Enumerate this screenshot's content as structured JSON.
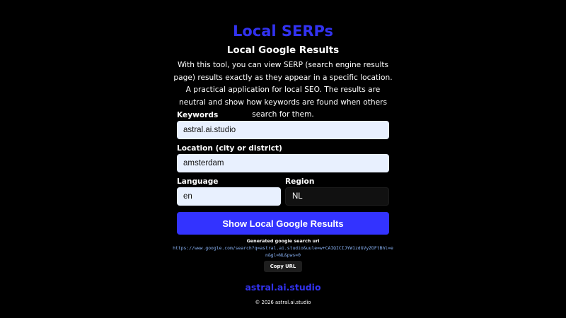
{
  "header": {
    "title": "Local SERPs",
    "subtitle": "Local Google Results",
    "description": "With this tool, you can view SERP (search engine results page) results exactly as they appear in a specific location. A practical application for local SEO. The results are neutral and show how keywords are found when others search for them."
  },
  "form": {
    "keywords": {
      "label": "Keywords",
      "value": "astral.ai.studio"
    },
    "location": {
      "label": "Location (city or district)",
      "value": "amsterdam"
    },
    "language": {
      "label": "Language",
      "value": "en"
    },
    "region": {
      "label": "Region",
      "value": "NL"
    },
    "submit_label": "Show Local Google Results"
  },
  "result": {
    "label": "Generated google search url",
    "url": "https://www.google.com/search?q=astral.ai.studio&uule=w+CAIQICIJYW1zdGVyZGFtBhl=en&gl=NL&pws=0",
    "copy_label": "Copy URL"
  },
  "footer": {
    "brand": "astral.ai.studio",
    "copyright": "© 2026 astral.ai.studio"
  },
  "colors": {
    "background": "#000000",
    "brand_blue": "#3232f0",
    "button_blue": "#3333ff",
    "input_light": "#e8f0fe",
    "input_dark": "#111111",
    "url_blue": "#8ab4f8"
  }
}
